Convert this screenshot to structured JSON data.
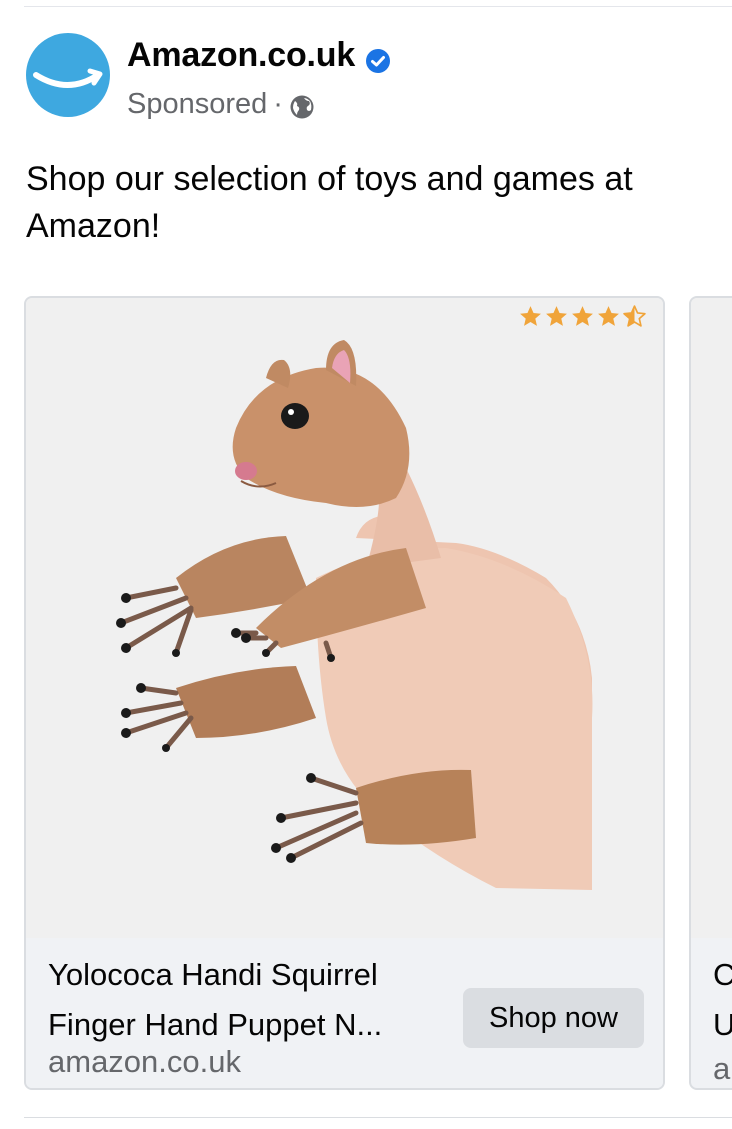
{
  "post": {
    "page_name": "Amazon.co.uk",
    "sponsored_label": "Sponsored",
    "separator": "·",
    "text": "Shop our selection of toys and games at Amazon!",
    "verified_icon": "verified-check-icon",
    "audience_icon": "globe-icon"
  },
  "carousel": {
    "cards": [
      {
        "rating": 4.5,
        "title_line1": "Yolococa Handi Squirrel",
        "title_line2": "Finger Hand Puppet N...",
        "domain": "amazon.co.uk",
        "cta": "Shop now",
        "image": "squirrel-finger-puppet-photo"
      },
      {
        "title_line1": "C",
        "title_line2": "U",
        "domain": "a"
      }
    ]
  },
  "colors": {
    "avatar_bg": "#3ea8e0",
    "verified_blue": "#1b74e4",
    "star_orange": "#f0a43a",
    "card_bg": "#f0f2f5",
    "button_bg": "#dadde1"
  }
}
